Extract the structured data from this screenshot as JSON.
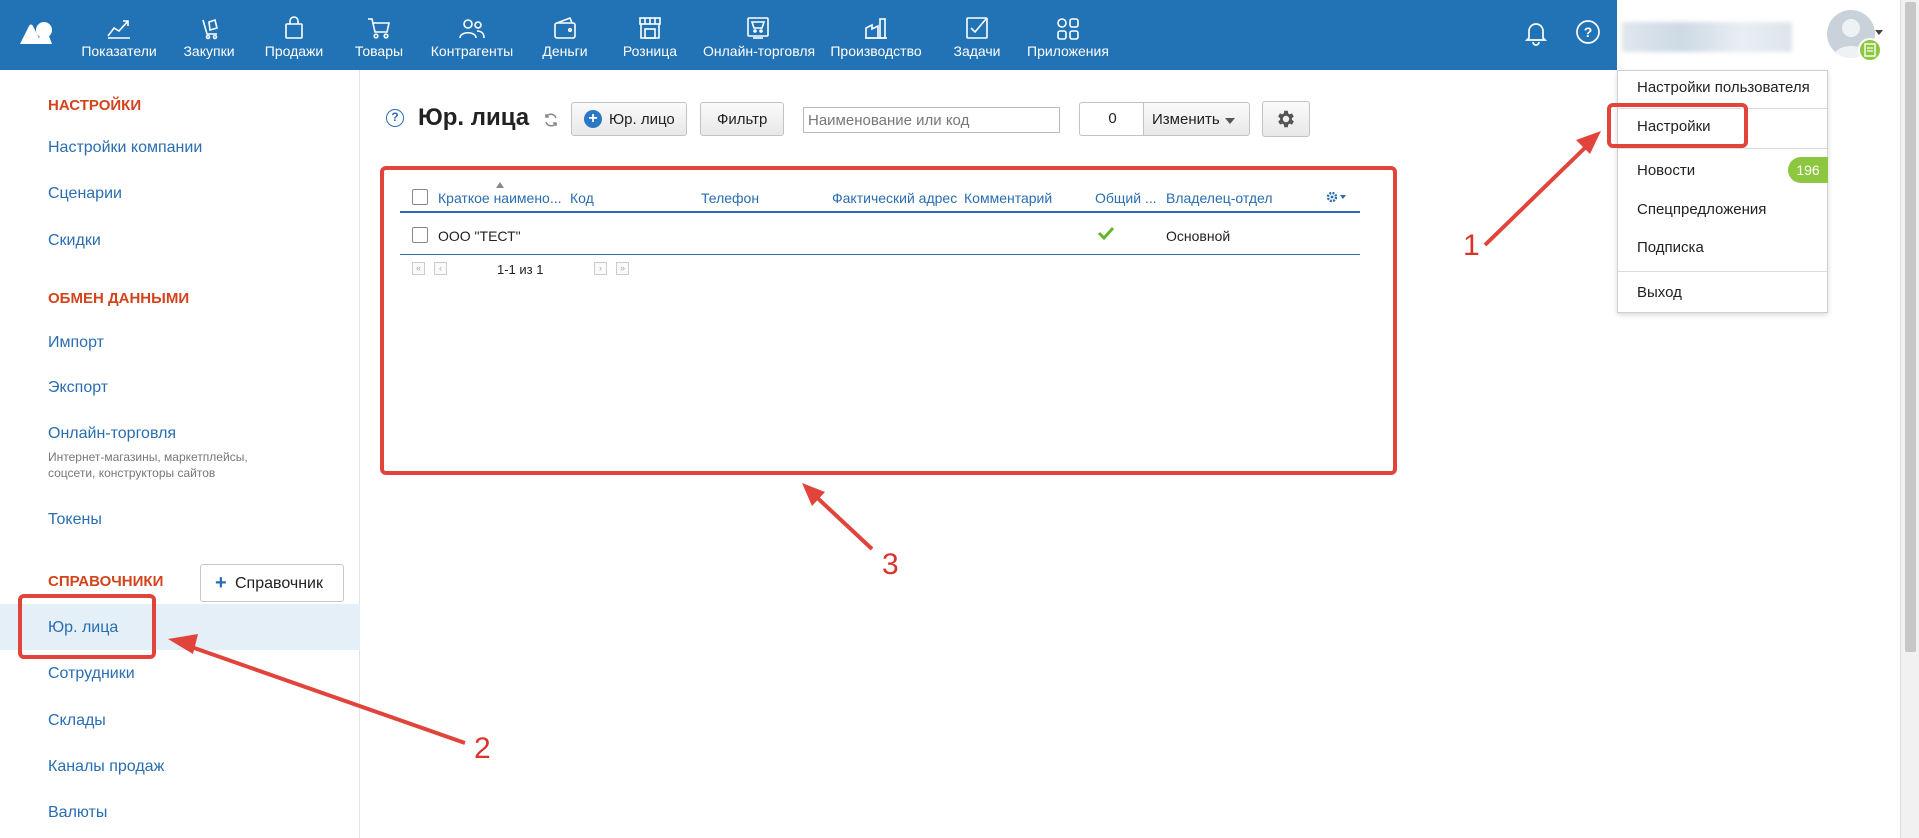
{
  "topnav": {
    "items": [
      {
        "label": "Показатели",
        "icon": "chart-line-icon"
      },
      {
        "label": "Закупки",
        "icon": "purchase-bag-icon"
      },
      {
        "label": "Продажи",
        "icon": "shopping-bag-icon"
      },
      {
        "label": "Товары",
        "icon": "cart-icon"
      },
      {
        "label": "Контрагенты",
        "icon": "people-icon"
      },
      {
        "label": "Деньги",
        "icon": "wallet-icon"
      },
      {
        "label": "Розница",
        "icon": "store-icon"
      },
      {
        "label": "Онлайн-торговля",
        "icon": "online-store-icon"
      },
      {
        "label": "Производство",
        "icon": "factory-icon"
      },
      {
        "label": "Задачи",
        "icon": "task-check-icon"
      },
      {
        "label": "Приложения",
        "icon": "apps-grid-icon"
      }
    ],
    "notifications_icon": "bell-icon",
    "help_icon": "help-icon"
  },
  "user_menu": {
    "items": [
      "Настройки пользователя",
      "Настройки",
      "Новости",
      "Спецпредложения",
      "Подписка",
      "Выход"
    ],
    "news_count": "196"
  },
  "sidebar": {
    "section_settings": "НАСТРОЙКИ",
    "settings_items": [
      "Настройки компании",
      "Сценарии",
      "Скидки"
    ],
    "section_exchange": "ОБМЕН ДАННЫМИ",
    "exchange_items": [
      "Импорт",
      "Экспорт",
      "Онлайн-торговля",
      "Токены"
    ],
    "online_trade_desc_1": "Интернет-магазины, маркетплейсы,",
    "online_trade_desc_2": "соцсети, конструкторы сайтов",
    "section_refs": "СПРАВОЧНИКИ",
    "add_ref_button": "Справочник",
    "ref_items": [
      "Юр. лица",
      "Сотрудники",
      "Склады",
      "Каналы продаж",
      "Валюты"
    ],
    "active_item": "Юр. лица"
  },
  "main": {
    "title": "Юр. лица",
    "new_button": "Юр. лицо",
    "filter_button": "Фильтр",
    "search_placeholder": "Наименование или код",
    "selected_count": "0",
    "change_button": "Изменить"
  },
  "table": {
    "columns": [
      "Краткое наимено...",
      "Код",
      "Телефон",
      "Фактический адрес",
      "Комментарий",
      "Общий ...",
      "Владелец-отдел"
    ],
    "rows": [
      {
        "name": "ООО \"ТЕСТ\"",
        "code": "",
        "phone": "",
        "address": "",
        "comment": "",
        "shared": true,
        "owner": "Основной"
      }
    ],
    "pager_text": "1-1 из 1"
  },
  "annotations": {
    "labels": [
      "1",
      "2",
      "3"
    ],
    "color": "#e0443a"
  },
  "colors": {
    "topbar": "#2273b5",
    "link": "#2a6db0",
    "heading": "#d4441c",
    "badge": "#8dc63f"
  }
}
